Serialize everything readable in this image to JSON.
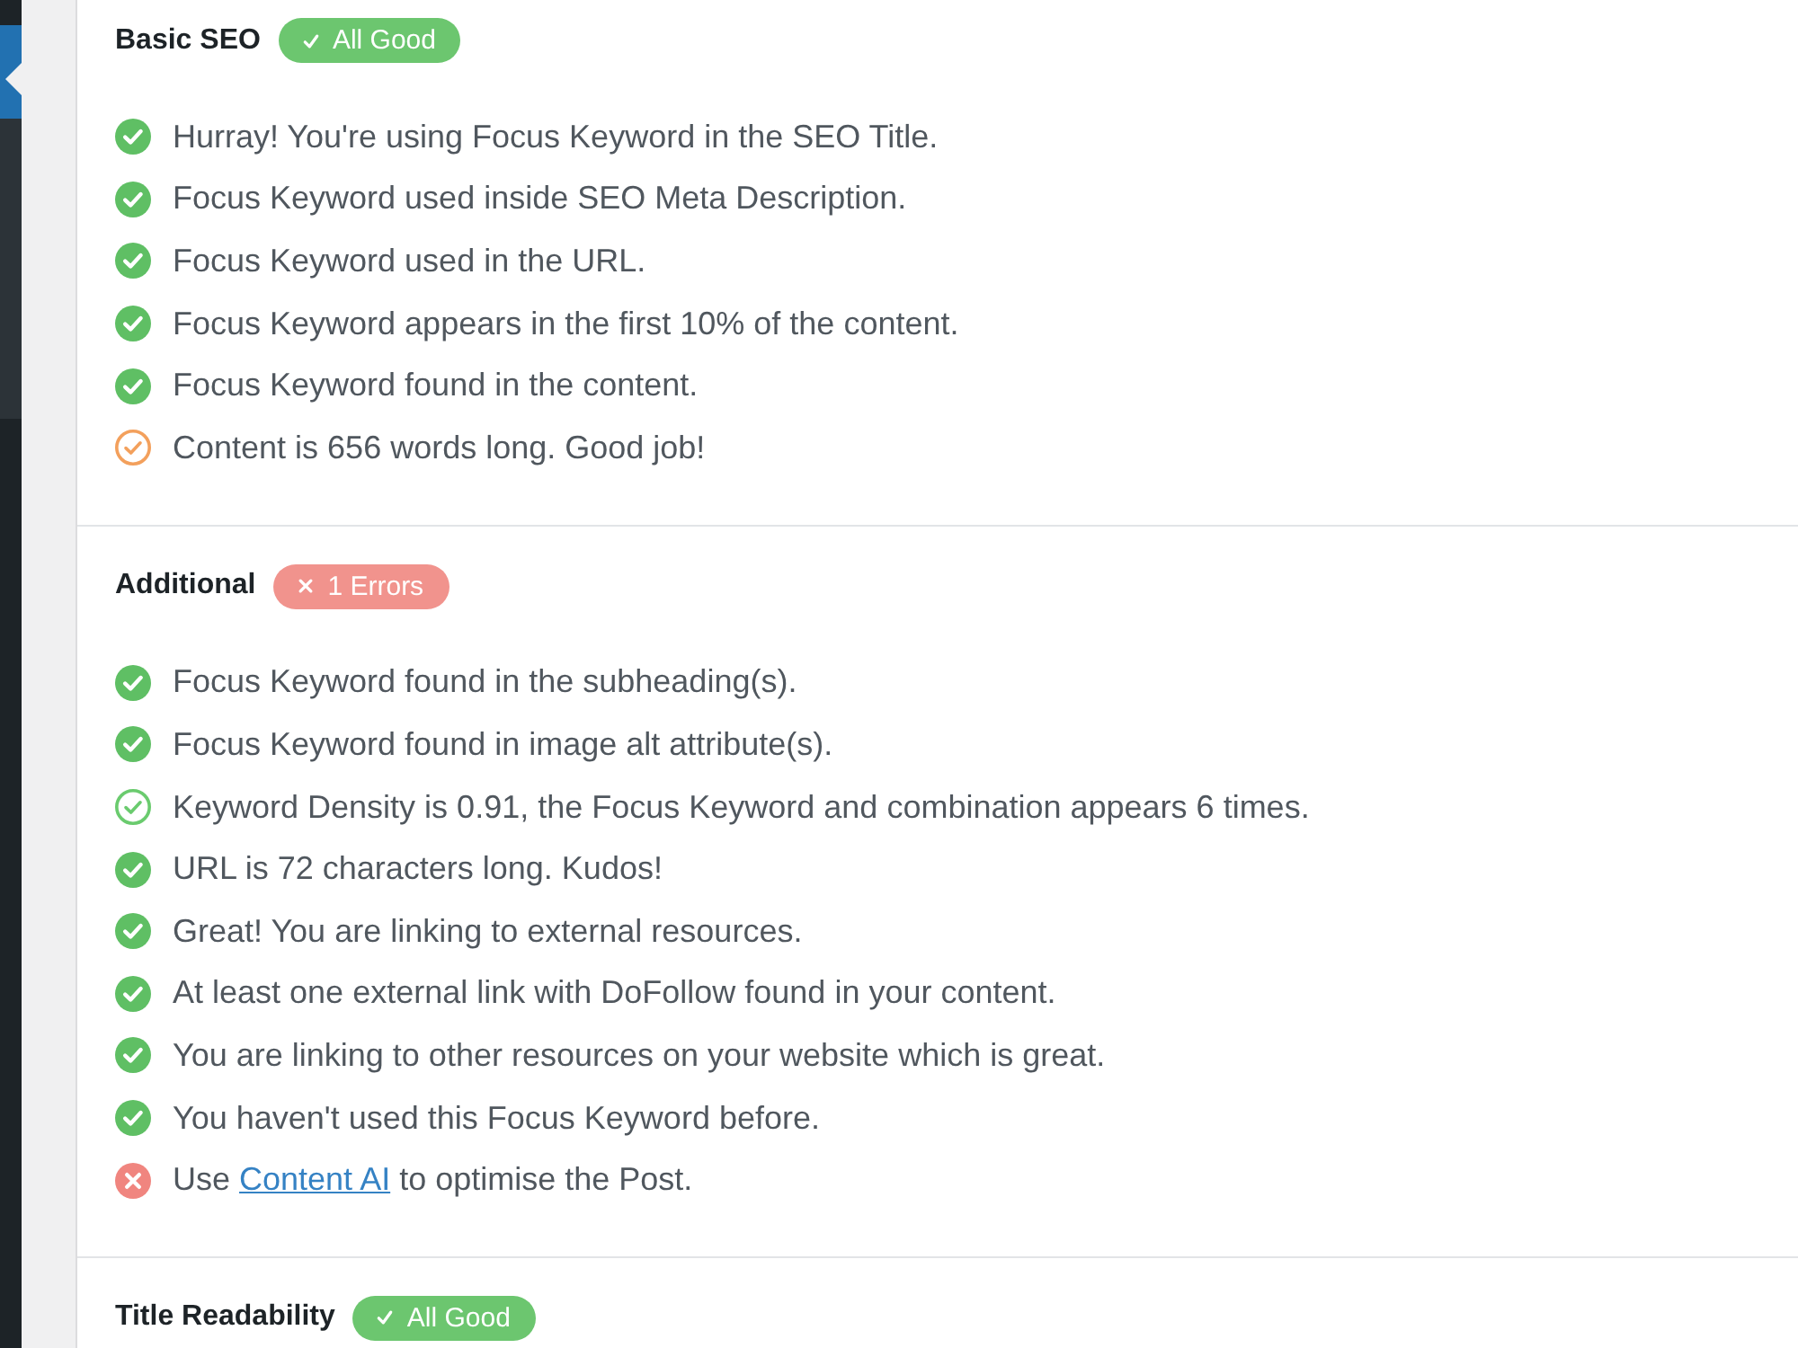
{
  "sections": [
    {
      "title": "Basic SEO",
      "badge": {
        "kind": "good",
        "label": "All Good"
      },
      "items": [
        {
          "kind": "ok",
          "text": "Hurray! You're using Focus Keyword in the SEO Title."
        },
        {
          "kind": "ok",
          "text": "Focus Keyword used inside SEO Meta Description."
        },
        {
          "kind": "ok",
          "text": "Focus Keyword used in the URL."
        },
        {
          "kind": "ok",
          "text": "Focus Keyword appears in the first 10% of the content."
        },
        {
          "kind": "ok",
          "text": "Focus Keyword found in the content."
        },
        {
          "kind": "warning",
          "text": "Content is 656 words long. Good job!"
        }
      ]
    },
    {
      "title": "Additional",
      "badge": {
        "kind": "error",
        "label": "1 Errors"
      },
      "items": [
        {
          "kind": "ok",
          "text": "Focus Keyword found in the subheading(s)."
        },
        {
          "kind": "ok",
          "text": "Focus Keyword found in image alt attribute(s)."
        },
        {
          "kind": "ok_outline",
          "text": "Keyword Density is 0.91, the Focus Keyword and combination appears 6 times."
        },
        {
          "kind": "ok",
          "text": "URL is 72 characters long. Kudos!"
        },
        {
          "kind": "ok",
          "text": "Great! You are linking to external resources."
        },
        {
          "kind": "ok",
          "text": "At least one external link with DoFollow found in your content."
        },
        {
          "kind": "ok",
          "text": "You are linking to other resources on your website which is great."
        },
        {
          "kind": "ok",
          "text": "You haven't used this Focus Keyword before."
        },
        {
          "kind": "fail",
          "text": "Use ",
          "link": "Content AI",
          "text_after": " to optimise the Post."
        }
      ]
    },
    {
      "title": "Title Readability",
      "badge": {
        "kind": "good",
        "label": "All Good"
      }
    }
  ]
}
